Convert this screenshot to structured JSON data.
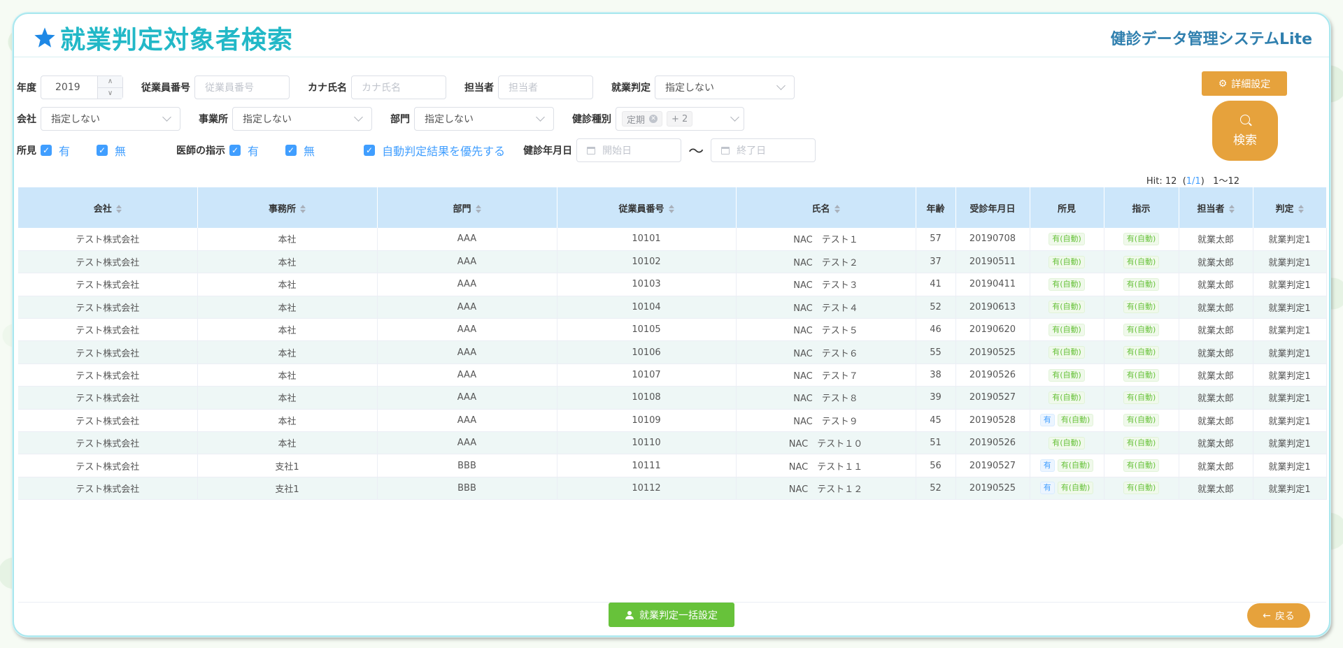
{
  "header": {
    "title": "就業判定対象者検索",
    "system_name": "健診データ管理システムLite"
  },
  "filters": {
    "year_label": "年度",
    "year_value": "2019",
    "employee_no_label": "従業員番号",
    "employee_no_placeholder": "従業員番号",
    "kana_label": "カナ氏名",
    "kana_placeholder": "カナ氏名",
    "staff_label": "担当者",
    "staff_placeholder": "担当者",
    "judgement_label": "就業判定",
    "judgement_value": "指定しない",
    "company_label": "会社",
    "company_value": "指定しない",
    "office_label": "事業所",
    "office_value": "指定しない",
    "dept_label": "部門",
    "dept_value": "指定しない",
    "checkup_type_label": "健診種別",
    "checkup_type_tag": "定期",
    "checkup_type_more": "+ 2",
    "findings_label": "所見",
    "findings_yes": "有",
    "findings_no": "無",
    "doctor_label": "医師の指示",
    "doctor_yes": "有",
    "doctor_no": "無",
    "auto_priority_label": "自動判定結果を優先する",
    "date_label": "健診年月日",
    "date_start_placeholder": "開始日",
    "date_end_placeholder": "終了日",
    "date_sep": "〜"
  },
  "buttons": {
    "detail": "詳細設定",
    "search": "検索",
    "bulk": "就業判定一括設定",
    "back": "戻る"
  },
  "hit": {
    "prefix": "Hit: 12",
    "page_open": "(",
    "page": "1/1",
    "page_close": ")",
    "range": "1〜12"
  },
  "table": {
    "columns": [
      "会社",
      "事務所",
      "部門",
      "従業員番号",
      "氏名",
      "年齢",
      "受診年月日",
      "所見",
      "指示",
      "担当者",
      "判定"
    ],
    "rows": [
      {
        "company": "テスト株式会社",
        "office": "本社",
        "dept": "AAA",
        "emp_no": "10101",
        "name": "NAC　テスト１",
        "age": "57",
        "date": "20190708",
        "findings": "有(自動)",
        "findings_yes": "",
        "instr": "有(自動)",
        "staff": "就業太郎",
        "judge": "就業判定1"
      },
      {
        "company": "テスト株式会社",
        "office": "本社",
        "dept": "AAA",
        "emp_no": "10102",
        "name": "NAC　テスト２",
        "age": "37",
        "date": "20190511",
        "findings": "有(自動)",
        "findings_yes": "",
        "instr": "有(自動)",
        "staff": "就業太郎",
        "judge": "就業判定1"
      },
      {
        "company": "テスト株式会社",
        "office": "本社",
        "dept": "AAA",
        "emp_no": "10103",
        "name": "NAC　テスト３",
        "age": "41",
        "date": "20190411",
        "findings": "有(自動)",
        "findings_yes": "",
        "instr": "有(自動)",
        "staff": "就業太郎",
        "judge": "就業判定1"
      },
      {
        "company": "テスト株式会社",
        "office": "本社",
        "dept": "AAA",
        "emp_no": "10104",
        "name": "NAC　テスト４",
        "age": "52",
        "date": "20190613",
        "findings": "有(自動)",
        "findings_yes": "",
        "instr": "有(自動)",
        "staff": "就業太郎",
        "judge": "就業判定1"
      },
      {
        "company": "テスト株式会社",
        "office": "本社",
        "dept": "AAA",
        "emp_no": "10105",
        "name": "NAC　テスト５",
        "age": "46",
        "date": "20190620",
        "findings": "有(自動)",
        "findings_yes": "",
        "instr": "有(自動)",
        "staff": "就業太郎",
        "judge": "就業判定1"
      },
      {
        "company": "テスト株式会社",
        "office": "本社",
        "dept": "AAA",
        "emp_no": "10106",
        "name": "NAC　テスト６",
        "age": "55",
        "date": "20190525",
        "findings": "有(自動)",
        "findings_yes": "",
        "instr": "有(自動)",
        "staff": "就業太郎",
        "judge": "就業判定1"
      },
      {
        "company": "テスト株式会社",
        "office": "本社",
        "dept": "AAA",
        "emp_no": "10107",
        "name": "NAC　テスト７",
        "age": "38",
        "date": "20190526",
        "findings": "有(自動)",
        "findings_yes": "",
        "instr": "有(自動)",
        "staff": "就業太郎",
        "judge": "就業判定1"
      },
      {
        "company": "テスト株式会社",
        "office": "本社",
        "dept": "AAA",
        "emp_no": "10108",
        "name": "NAC　テスト８",
        "age": "39",
        "date": "20190527",
        "findings": "有(自動)",
        "findings_yes": "",
        "instr": "有(自動)",
        "staff": "就業太郎",
        "judge": "就業判定1"
      },
      {
        "company": "テスト株式会社",
        "office": "本社",
        "dept": "AAA",
        "emp_no": "10109",
        "name": "NAC　テスト９",
        "age": "45",
        "date": "20190528",
        "findings": "有(自動)",
        "findings_yes": "有",
        "instr": "有(自動)",
        "staff": "就業太郎",
        "judge": "就業判定1"
      },
      {
        "company": "テスト株式会社",
        "office": "本社",
        "dept": "AAA",
        "emp_no": "10110",
        "name": "NAC　テスト１０",
        "age": "51",
        "date": "20190526",
        "findings": "有(自動)",
        "findings_yes": "",
        "instr": "有(自動)",
        "staff": "就業太郎",
        "judge": "就業判定1"
      },
      {
        "company": "テスト株式会社",
        "office": "支社1",
        "dept": "BBB",
        "emp_no": "10111",
        "name": "NAC　テスト１１",
        "age": "56",
        "date": "20190527",
        "findings": "有(自動)",
        "findings_yes": "有",
        "instr": "有(自動)",
        "staff": "就業太郎",
        "judge": "就業判定1"
      },
      {
        "company": "テスト株式会社",
        "office": "支社1",
        "dept": "BBB",
        "emp_no": "10112",
        "name": "NAC　テスト１２",
        "age": "52",
        "date": "20190525",
        "findings": "有(自動)",
        "findings_yes": "有",
        "instr": "有(自動)",
        "staff": "就業太郎",
        "judge": "就業判定1"
      }
    ]
  },
  "colors": {
    "title": "#22b8c7",
    "system_name": "#2f7fae",
    "accent_orange": "#e6a23c",
    "accent_green": "#67c23a",
    "checkbox_blue": "#409eff",
    "table_header": "#cce6fa"
  }
}
